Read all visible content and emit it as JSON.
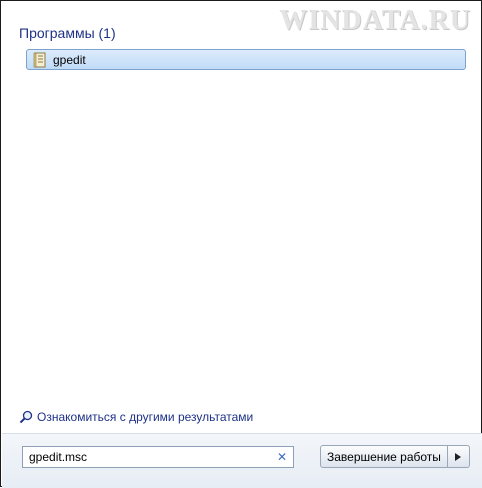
{
  "watermark": "WINDATA.RU",
  "results": {
    "group_title": "Программы (1)",
    "items": [
      {
        "label": "gpedit",
        "icon": "policy-document-icon"
      }
    ]
  },
  "see_more": {
    "label": "Ознакомиться с другими результатами",
    "icon": "magnifier-icon"
  },
  "search": {
    "value": "gpedit.msc",
    "clear_icon": "close-icon"
  },
  "shutdown": {
    "label": "Завершение работы",
    "arrow_icon": "triangle-right-icon"
  },
  "colors": {
    "link_blue": "#1e3287",
    "selection_fill": "#c1dcf7",
    "selection_border": "#7da2ce"
  }
}
